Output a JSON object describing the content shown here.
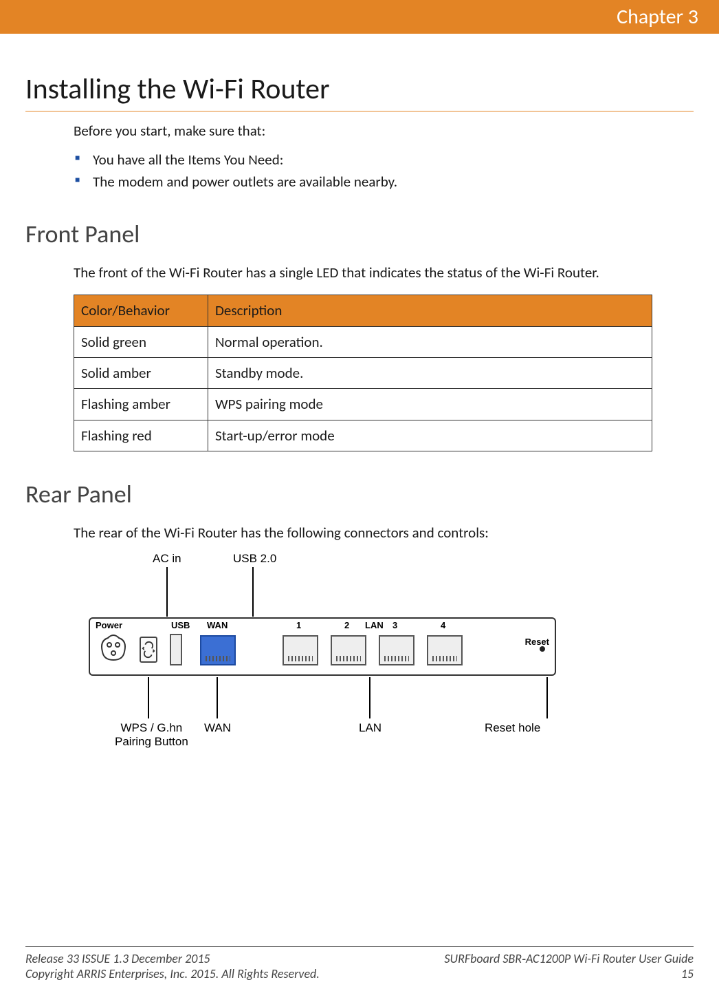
{
  "header": {
    "chapter": "Chapter 3"
  },
  "title": "Installing the Wi-Fi Router",
  "intro": "Before you start, make sure that:",
  "bullets": [
    "You have all the Items You Need:",
    "The modem and power outlets are available nearby."
  ],
  "front": {
    "heading": "Front Panel",
    "text": "The front of the Wi-Fi Router has a single LED that indicates the status of the Wi-Fi Router.",
    "table": {
      "head": [
        "Color/Behavior",
        "Description"
      ],
      "rows": [
        [
          "Solid green",
          "Normal operation."
        ],
        [
          "Solid amber",
          "Standby mode."
        ],
        [
          "Flashing amber",
          "WPS pairing mode"
        ],
        [
          "Flashing red",
          "Start-up/error mode"
        ]
      ]
    }
  },
  "rear": {
    "heading": "Rear Panel",
    "text": "The rear of the Wi-Fi Router has the following connectors and controls:",
    "labels": {
      "ac_in": "AC in",
      "usb20": "USB 2.0",
      "power": "Power",
      "usb": "USB",
      "wan_top": "WAN",
      "lan_nums": [
        "1",
        "2",
        "3",
        "4"
      ],
      "lan": "LAN",
      "reset": "Reset",
      "wps": "WPS / G.hn\nPairing Button",
      "wan_bottom": "WAN",
      "lan_bottom": "LAN",
      "reset_hole": "Reset hole"
    }
  },
  "footer": {
    "left1": "Release 33 ISSUE 1.3    December 2015",
    "right1": "SURFboard SBR‑AC1200P Wi-Fi Router User Guide",
    "left2": "Copyright ARRIS Enterprises, Inc. 2015. All Rights Reserved.",
    "right2": "15"
  }
}
